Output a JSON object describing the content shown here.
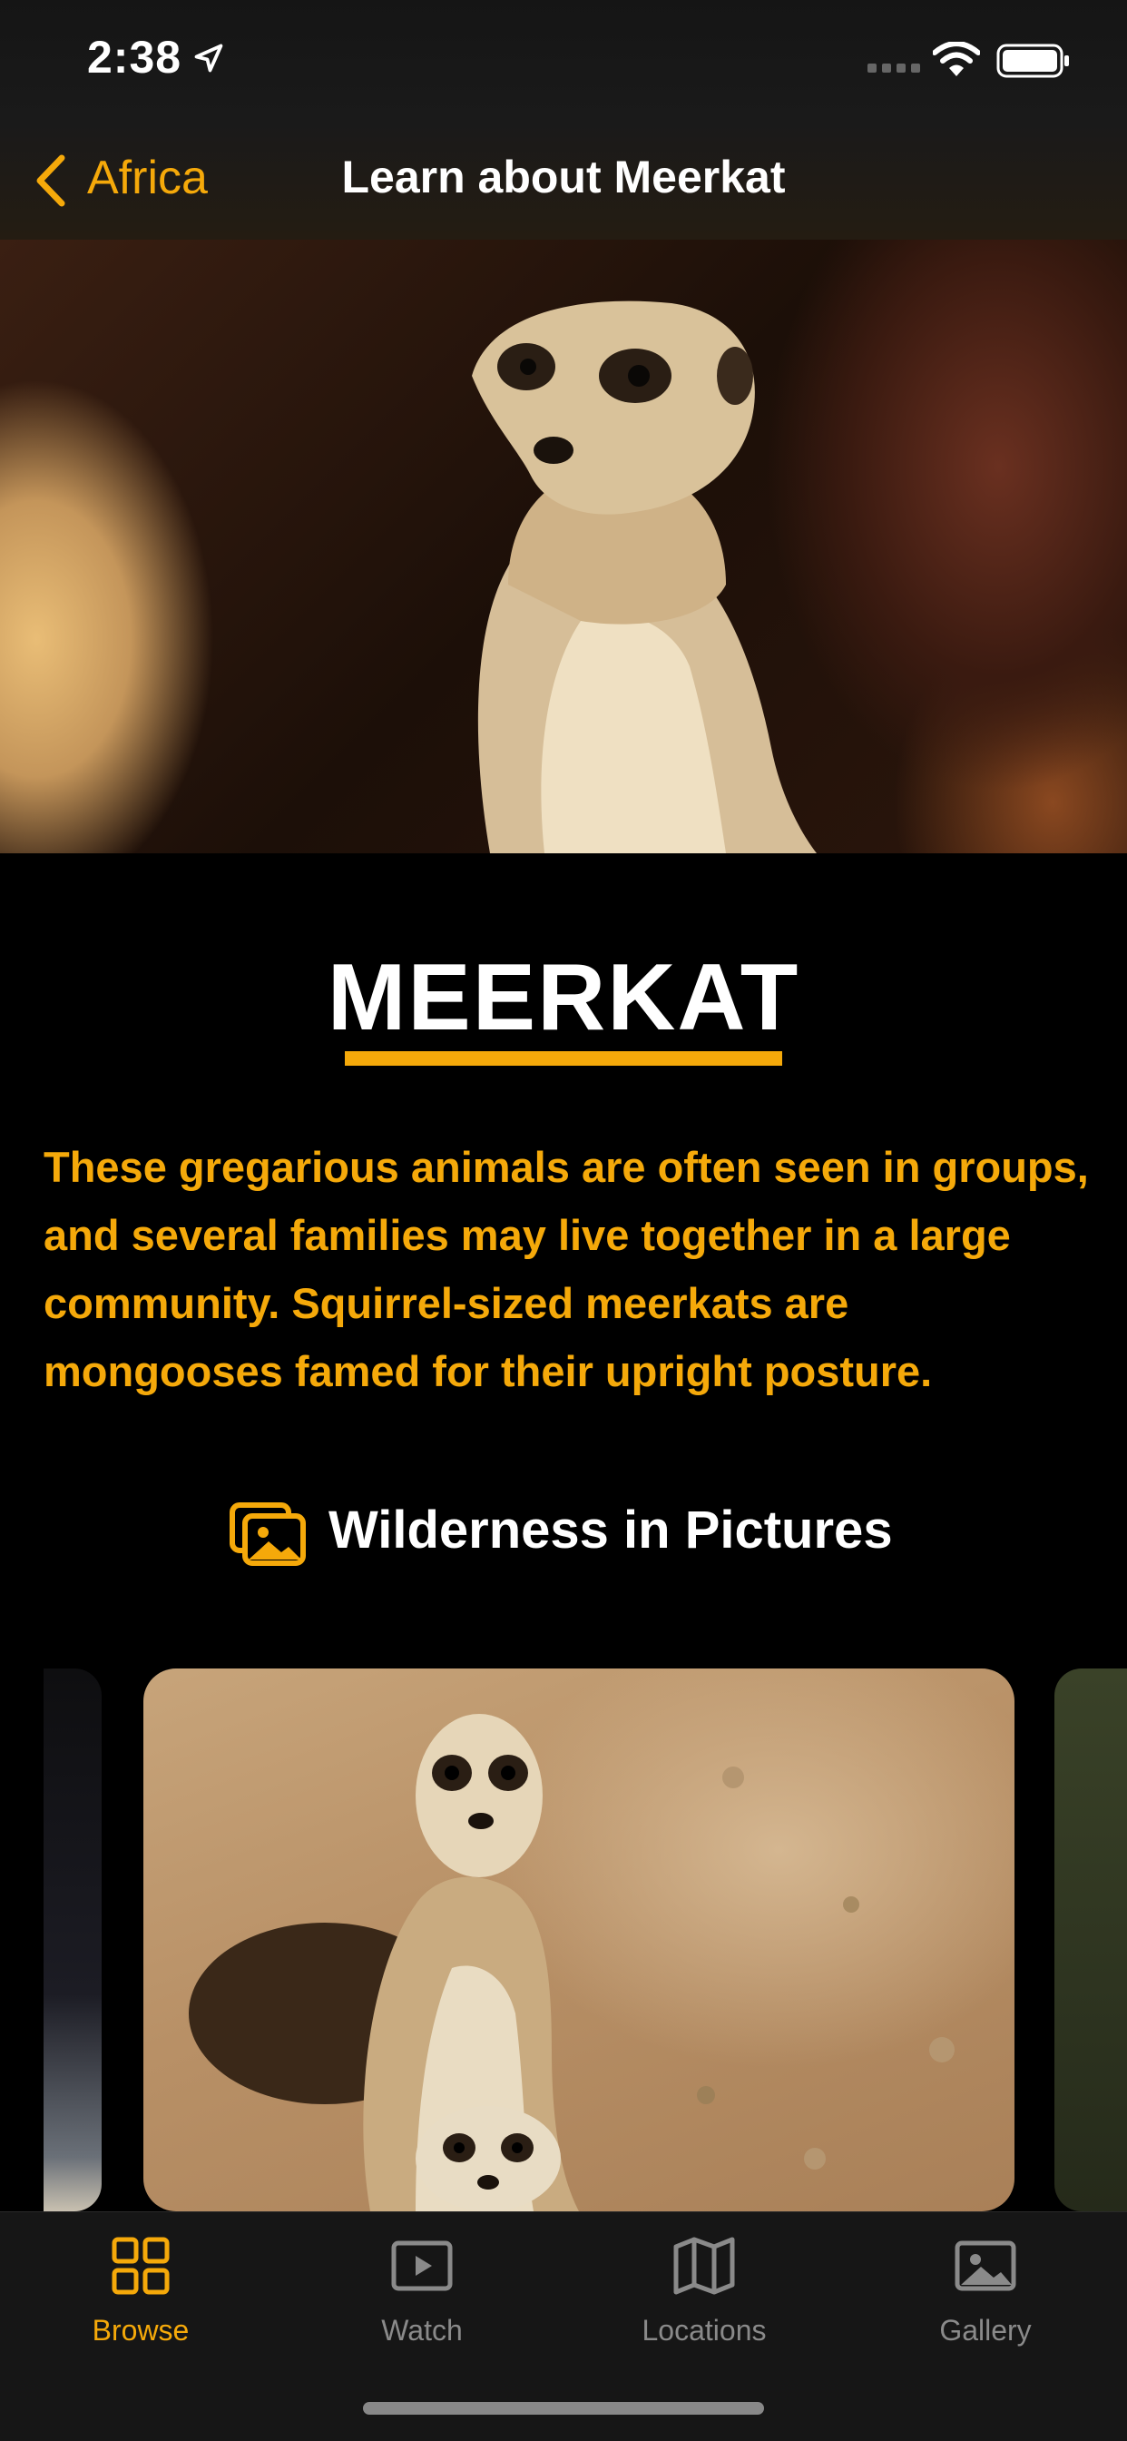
{
  "status_bar": {
    "time": "2:38"
  },
  "nav": {
    "back_label": "Africa",
    "title": "Learn about Meerkat"
  },
  "animal": {
    "name": "MEERKAT",
    "description": "These gregarious animals are often seen in groups, and several families may live together in a large community. Squirrel-sized meerkats are mongooses famed for their upright posture."
  },
  "gallery": {
    "section_title": "Wilderness in Pictures"
  },
  "tabs": [
    {
      "label": "Browse",
      "icon": "grid-icon",
      "active": true
    },
    {
      "label": "Watch",
      "icon": "play-icon",
      "active": false
    },
    {
      "label": "Locations",
      "icon": "map-icon",
      "active": false
    },
    {
      "label": "Gallery",
      "icon": "photo-icon",
      "active": false
    }
  ],
  "colors": {
    "accent": "#f5a90a",
    "background": "#000000",
    "tab_inactive": "#8a8a8a"
  }
}
